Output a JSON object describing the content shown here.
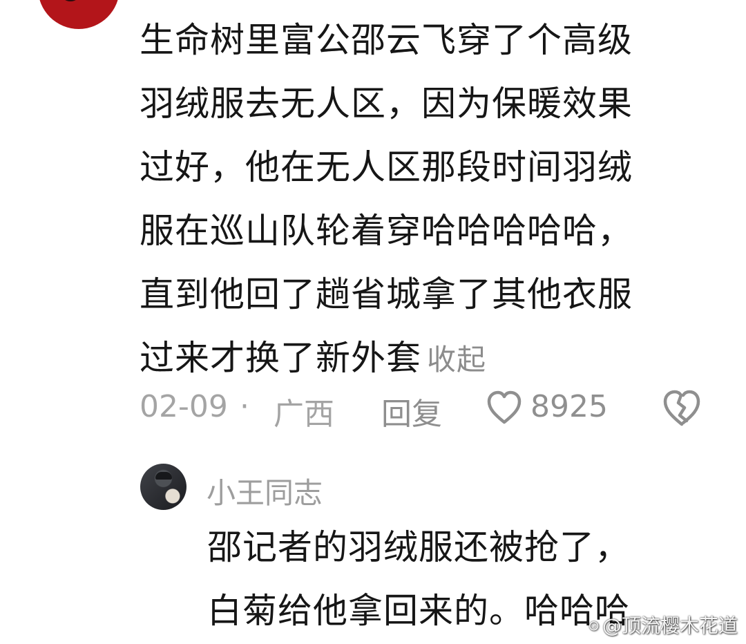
{
  "comment": {
    "lines": [
      "生命树里富公邵云飞穿了个高级",
      "羽绒服去无人区，因为保暖效果",
      "过好，他在无人区那段时间羽绒",
      "服在巡山队轮着穿哈哈哈哈哈，",
      "直到他回了趟省城拿了其他衣服",
      "过来才换了新外套"
    ],
    "collapse_label": "收起",
    "date": "02-09",
    "separator": "·",
    "location": "广西",
    "reply_label": "回复",
    "like_count": "8925",
    "like_icon": "heart-outline-icon",
    "dislike_icon": "broken-heart-icon"
  },
  "reply": {
    "username": "小王同志",
    "lines": [
      "邵记者的羽绒服还被抢了，",
      "白菊给他拿回来的。哈哈哈"
    ]
  },
  "watermark": {
    "symbol": "⊙",
    "text": "@顶流樱木花道"
  },
  "colors": {
    "main_text": "#161616",
    "secondary_text": "#9d9d9d",
    "icon": "#8f8f8f",
    "background": "#ffffff"
  }
}
